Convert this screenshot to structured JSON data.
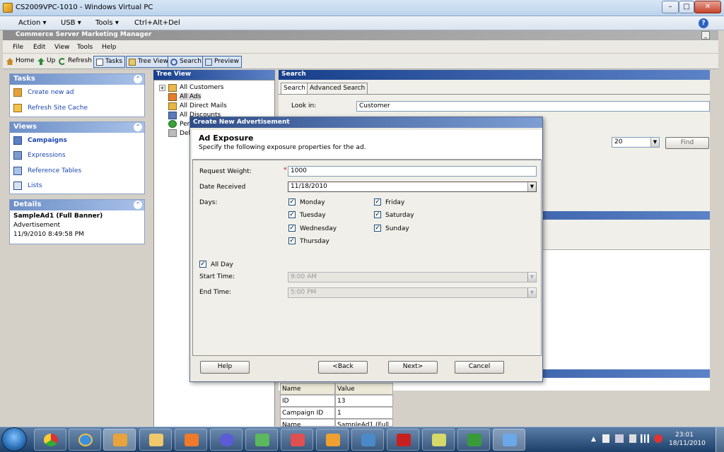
{
  "vpc": {
    "title": "CS2009VPC-1010 - Windows Virtual PC",
    "menu": [
      "Action ▾",
      "USB ▾",
      "Tools ▾",
      "Ctrl+Alt+Del"
    ],
    "help": "?"
  },
  "app": {
    "title": "Commerce Server Marketing Manager",
    "menu": [
      "File",
      "Edit",
      "View",
      "Tools",
      "Help"
    ],
    "toolbar": [
      "Home",
      "Up",
      "Refresh",
      "Tasks",
      "Tree View",
      "Search",
      "Preview"
    ]
  },
  "tasks": {
    "title": "Tasks",
    "items": [
      "Create new ad",
      "Refresh Site Cache"
    ]
  },
  "views": {
    "title": "Views",
    "items": [
      "Campaigns",
      "Expressions",
      "Reference Tables",
      "Lists"
    ]
  },
  "details": {
    "title": "Details",
    "name": "SampleAd1 (Full Banner)",
    "type": "Advertisement",
    "date": "11/9/2010 8:49:58 PM"
  },
  "tree": {
    "title": "Tree View",
    "root": "All Customers",
    "items": [
      "All Ads",
      "All Direct Mails",
      "All Discounts",
      "Per",
      "Del"
    ]
  },
  "search": {
    "title": "Search",
    "tabs": [
      "Search",
      "Advanced Search"
    ],
    "look_in_label": "Look in:",
    "look_in_value": "Customer",
    "count_value": "20",
    "find_label": "Find"
  },
  "grid": {
    "headers": [
      "Name",
      "Value"
    ],
    "rows": [
      [
        "ID",
        "13"
      ],
      [
        "Campaign ID",
        "1"
      ],
      [
        "Name",
        "SampleAd1 (Full ..."
      ]
    ]
  },
  "dialog": {
    "title": "Create New Advertisement",
    "heading": "Ad Exposure",
    "subheading": "Specify the following exposure properties for the ad.",
    "request_weight_label": "Request Weight:",
    "request_weight_value": "1000",
    "required_mark": "*",
    "date_received_label": "Date Received",
    "date_received_value": "11/18/2010",
    "days_label": "Days:",
    "days": [
      "Monday",
      "Tuesday",
      "Wednesday",
      "Thursday",
      "Friday",
      "Saturday",
      "Sunday"
    ],
    "check_mark": "✓",
    "all_day_label": "All Day",
    "start_time_label": "Start Time:",
    "start_time_value": "9:00 AM",
    "end_time_label": "End Time:",
    "end_time_value": "5:00 PM",
    "buttons": {
      "help": "Help",
      "back": "<Back",
      "next": "Next>",
      "cancel": "Cancel"
    }
  },
  "taskbar": {
    "time": "23:01",
    "date": "18/11/2010"
  }
}
